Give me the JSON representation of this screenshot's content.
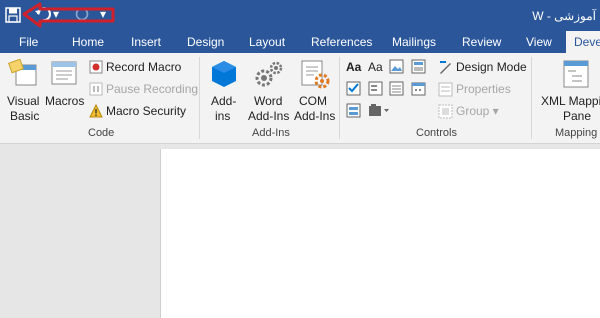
{
  "titlebar": {
    "title": "آموزشی - W",
    "undo_dropdown": "▾",
    "customize_dropdown": "▾"
  },
  "tabs": [
    "File",
    "Home",
    "Insert",
    "Design",
    "Layout",
    "References",
    "Mailings",
    "Review",
    "View",
    "Deve"
  ],
  "ribbon": {
    "code": {
      "visual_basic": [
        "Visual",
        "Basic"
      ],
      "macros": "Macros",
      "record_macro": "Record Macro",
      "pause_recording": "Pause Recording",
      "macro_security": "Macro Security",
      "group_label": "Code"
    },
    "addins": {
      "addins": [
        "Add-",
        "ins"
      ],
      "word_addins": [
        "Word",
        "Add-Ins"
      ],
      "com_addins": [
        "COM",
        "Add-Ins"
      ],
      "group_label": "Add-Ins"
    },
    "controls": {
      "design_mode": "Design Mode",
      "properties": "Properties",
      "group": "Group ▾",
      "group_label": "Controls",
      "text_glyph": "Aa"
    },
    "mapping": {
      "xml_mapping": [
        "XML Mappi",
        "Pane"
      ],
      "group_label": "Mapping"
    }
  },
  "colors": {
    "title_blue": "#2b579a",
    "annotation_red": "#d0202b",
    "ribbon_bg": "#f3f3f3"
  }
}
